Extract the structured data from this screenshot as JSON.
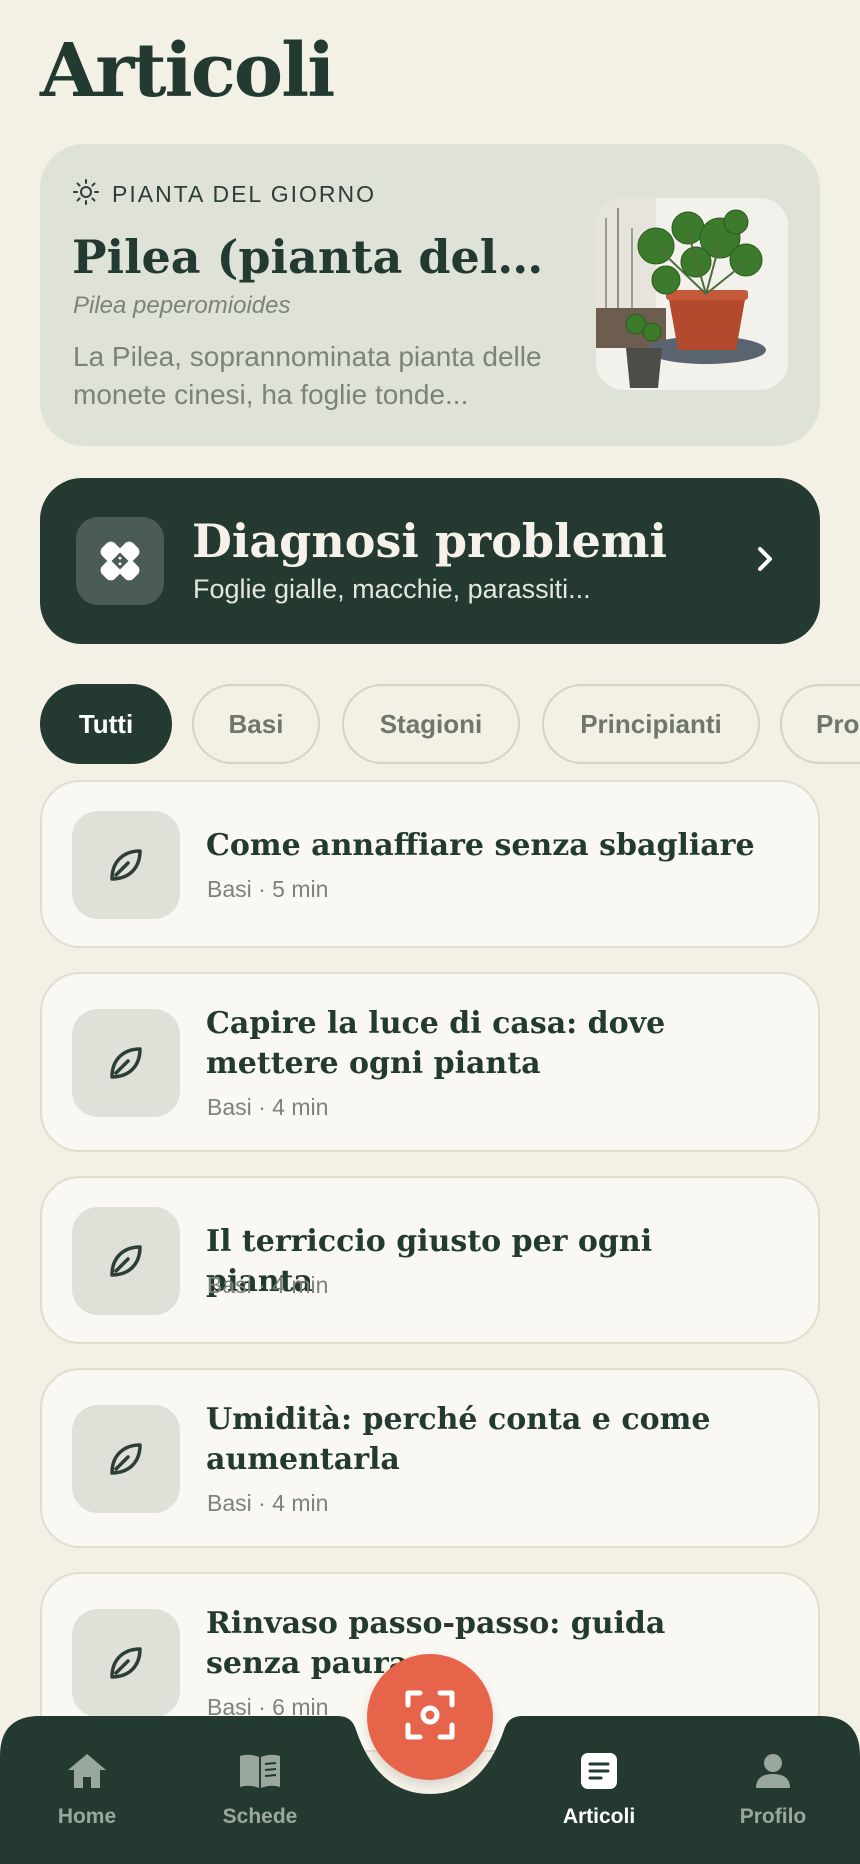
{
  "page": {
    "title": "Articoli"
  },
  "plant_of_day": {
    "label": "PIANTA DEL GIORNO",
    "name": "Pilea (pianta delle monete cinesi)",
    "scientific_name": "Pilea peperomioides",
    "description": "La Pilea, soprannominata pianta delle monete cinesi, ha foglie tonde...",
    "icon": "sun-icon"
  },
  "diagnosis": {
    "title": "Diagnosi problemi",
    "subtitle": "Foglie gialle, macchie, parassiti...",
    "icon": "bandage-icon"
  },
  "filters": {
    "chips": [
      "Tutti",
      "Basi",
      "Stagioni",
      "Principianti",
      "Pro"
    ],
    "selected": "Tutti"
  },
  "articles": [
    {
      "title": "Come annaffiare senza sbagliare",
      "meta": "Basi · 5 min"
    },
    {
      "title": "Capire la luce di casa: dove mettere ogni pianta",
      "meta": "Basi · 4 min"
    },
    {
      "title": "Il terriccio giusto per ogni pianta",
      "meta": "Basi · 4 min"
    },
    {
      "title": "Umidità: perché conta e come aumentarla",
      "meta": "Basi · 4 min"
    },
    {
      "title": "Rinvaso passo-passo: guida senza paura",
      "meta": "Basi · 6 min"
    }
  ],
  "nav": {
    "items": [
      {
        "label": "Home",
        "icon": "home-icon"
      },
      {
        "label": "Schede",
        "icon": "book-icon"
      },
      {
        "label": "Articoli",
        "icon": "article-icon"
      },
      {
        "label": "Profilo",
        "icon": "profile-icon"
      }
    ],
    "active": "Articoli",
    "scan_icon": "scan-icon"
  },
  "colors": {
    "background": "#f3f0e6",
    "dark_green": "#243a30",
    "accent": "#e6654a",
    "card": "#dfe2d7"
  }
}
